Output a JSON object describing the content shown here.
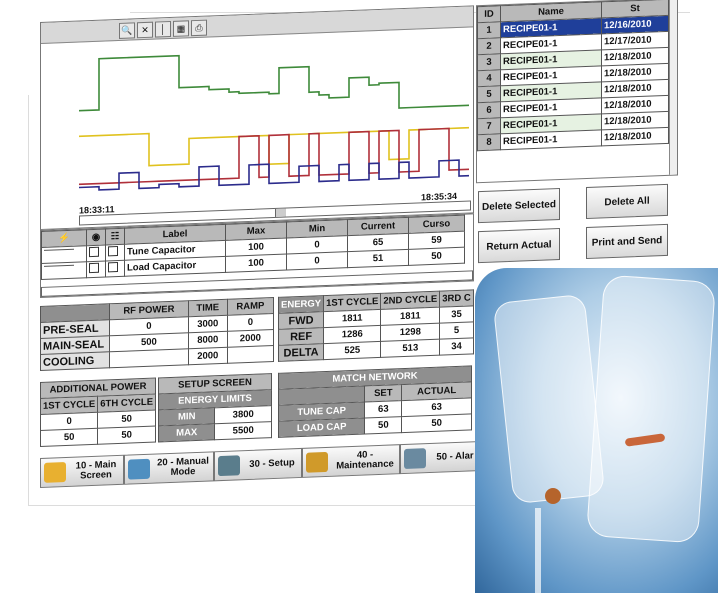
{
  "chart_data": {
    "type": "line",
    "x_start_label": "18:33:11",
    "x_end_label": "18:35:34",
    "series": [
      {
        "color": "#3e8a3a",
        "values": [
          0.42,
          0.42,
          0.1,
          0.1,
          0.1,
          0.1,
          0.1,
          0.1,
          0.1,
          0.1,
          0.3,
          0.3,
          0.3,
          0.32,
          0.32,
          0.34,
          0.35,
          0.35,
          0.35,
          0.36,
          0.2,
          0.2,
          0.2,
          0.36,
          0.38,
          0.4,
          0.4,
          0.28,
          0.28,
          0.33,
          0.32,
          0.32,
          0.48,
          0.48,
          0.48,
          0.48,
          0.48,
          0.48,
          0.48,
          0.48
        ]
      },
      {
        "color": "#e0c21f",
        "values": [
          0.58,
          0.58,
          0.58,
          0.58,
          0.58,
          0.58,
          0.58,
          0.78,
          0.78,
          0.78,
          0.78,
          0.62,
          0.62,
          0.62,
          0.62,
          0.62,
          0.62,
          0.62,
          0.62,
          0.8,
          0.8,
          0.62,
          0.62,
          0.62,
          0.62,
          0.62,
          0.62,
          0.62,
          0.62,
          0.62,
          0.62,
          0.8,
          0.8,
          0.62,
          0.62,
          0.62,
          0.62,
          0.62,
          0.62,
          0.62
        ]
      },
      {
        "color": "#b0303a",
        "values": [
          0.88,
          0.88,
          0.88,
          0.88,
          0.88,
          0.88,
          0.88,
          0.88,
          0.88,
          0.88,
          0.88,
          0.88,
          0.88,
          0.88,
          0.88,
          0.88,
          0.62,
          0.62,
          0.88,
          0.62,
          0.62,
          0.88,
          0.88,
          0.62,
          0.88,
          0.88,
          0.88,
          0.62,
          0.62,
          0.88,
          0.62,
          0.62,
          0.88,
          0.88,
          0.62,
          0.62,
          0.62,
          0.88,
          0.88,
          0.88
        ]
      },
      {
        "color": "#2c2c8c",
        "values": [
          0.9,
          0.9,
          0.92,
          0.92,
          0.82,
          0.82,
          0.92,
          0.92,
          0.9,
          0.9,
          0.92,
          0.92,
          0.8,
          0.8,
          0.92,
          0.92,
          0.92,
          0.8,
          0.8,
          0.92,
          0.92,
          0.92,
          0.82,
          0.82,
          0.92,
          0.92,
          0.82,
          0.92,
          0.92,
          0.82,
          0.92,
          0.92,
          0.82,
          0.92,
          0.92,
          0.92,
          0.82,
          0.82,
          0.92,
          0.92
        ]
      }
    ]
  },
  "recipe_table": {
    "headers": [
      "ID",
      "Name",
      "St"
    ],
    "rows": [
      {
        "id": "1",
        "name": "RECIPE01-1",
        "date": "12/16/2010"
      },
      {
        "id": "2",
        "name": "RECIPE01-1",
        "date": "12/17/2010"
      },
      {
        "id": "3",
        "name": "RECIPE01-1",
        "date": "12/18/2010"
      },
      {
        "id": "4",
        "name": "RECIPE01-1",
        "date": "12/18/2010"
      },
      {
        "id": "5",
        "name": "RECIPE01-1",
        "date": "12/18/2010"
      },
      {
        "id": "6",
        "name": "RECIPE01-1",
        "date": "12/18/2010"
      },
      {
        "id": "7",
        "name": "RECIPE01-1",
        "date": "12/18/2010"
      },
      {
        "id": "8",
        "name": "RECIPE01-1",
        "date": "12/18/2010"
      }
    ]
  },
  "buttons": {
    "delete_selected": "Delete Selected",
    "delete_all": "Delete All",
    "return_actual": "Return Actual",
    "print_send": "Print and Send"
  },
  "pens": {
    "headers": [
      "Label",
      "Max",
      "Min",
      "Current",
      "Curso"
    ],
    "rows": [
      {
        "label": "Tune Capacitor",
        "max": "100",
        "min": "0",
        "current": "65",
        "cursor": "59"
      },
      {
        "label": "Load Capacitor",
        "max": "100",
        "min": "0",
        "current": "51",
        "cursor": "50"
      }
    ]
  },
  "seal_table": {
    "headers": [
      "RF POWER",
      "TIME",
      "RAMP"
    ],
    "rows": [
      {
        "label": "PRE-SEAL",
        "rf": "0",
        "time": "3000",
        "ramp": "0"
      },
      {
        "label": "MAIN-SEAL",
        "rf": "500",
        "time": "8000",
        "ramp": "2000"
      },
      {
        "label": "COOLING",
        "rf": "",
        "time": "2000",
        "ramp": ""
      }
    ]
  },
  "energy_table": {
    "headers": [
      "ENERGY",
      "1ST CYCLE",
      "2ND CYCLE",
      "3RD C"
    ],
    "rows": [
      {
        "label": "FWD",
        "c1": "1811",
        "c2": "1811",
        "c3": "35"
      },
      {
        "label": "REF",
        "c1": "1286",
        "c2": "1298",
        "c3": "5"
      },
      {
        "label": "DELTA",
        "c1": "525",
        "c2": "513",
        "c3": "34"
      }
    ]
  },
  "additional_power": {
    "title": "ADDITIONAL POWER",
    "headers": [
      "1ST CYCLE",
      "6TH CYCLE"
    ],
    "rows": [
      [
        "0",
        "50"
      ],
      [
        "50",
        "50"
      ]
    ]
  },
  "setup_screen": {
    "title": "SETUP SCREEN",
    "subtitle": "ENERGY LIMITS",
    "rows": [
      {
        "label": "MIN",
        "value": "3800"
      },
      {
        "label": "MAX",
        "value": "5500"
      }
    ]
  },
  "match_network": {
    "title": "MATCH NETWORK",
    "headers": [
      "SET",
      "ACTUAL"
    ],
    "rows": [
      {
        "label": "TUNE CAP",
        "set": "63",
        "actual": "63"
      },
      {
        "label": "LOAD CAP",
        "set": "50",
        "actual": "50"
      }
    ]
  },
  "nav": [
    {
      "label": "10 - Main Screen",
      "icon": "home-icon",
      "color": "#e8b030"
    },
    {
      "label": "20 - Manual Mode",
      "icon": "manual-icon",
      "color": "#4f8fc0"
    },
    {
      "label": "30 - Setup",
      "icon": "setup-icon",
      "color": "#5a7d8c"
    },
    {
      "label": "40 - Maintenance",
      "icon": "maintenance-icon",
      "color": "#d09a2a"
    },
    {
      "label": "50 - Alar",
      "icon": "alarm-icon",
      "color": "#6a8aa0"
    }
  ]
}
